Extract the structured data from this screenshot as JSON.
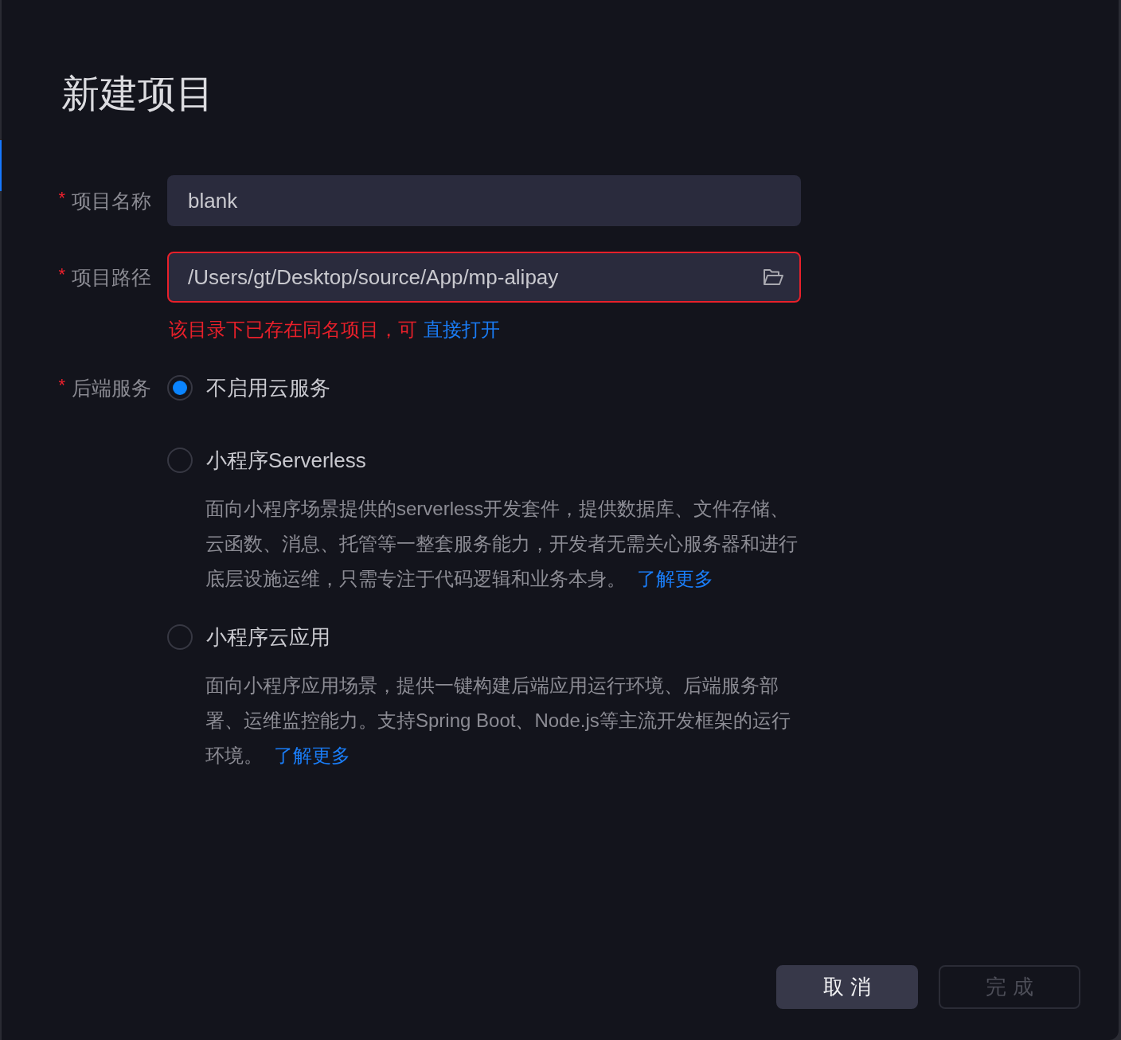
{
  "dialog": {
    "title": "新建项目"
  },
  "fields": [
    {
      "kind": "text",
      "required_mark": "*",
      "label": "项目名称",
      "value": "blank",
      "invalid": false
    },
    {
      "kind": "path",
      "required_mark": "*",
      "label": "项目路径",
      "value": "/Users/gt/Desktop/source/App/mp-alipay",
      "invalid": true,
      "error": {
        "text": "该目录下已存在同名项目，可",
        "link": "直接打开"
      }
    }
  ],
  "backend": {
    "required_mark": "*",
    "label": "后端服务",
    "options": [
      {
        "label": "不启用云服务",
        "selected": true
      },
      {
        "label": "小程序Serverless",
        "selected": false,
        "description": "面向小程序场景提供的serverless开发套件，提供数据库、文件存储、云函数、消息、托管等一整套服务能力，开发者无需关心服务器和进行底层设施运维，只需专注于代码逻辑和业务本身。",
        "link": "了解更多"
      },
      {
        "label": "小程序云应用",
        "selected": false,
        "description": "面向小程序应用场景，提供一键构建后端应用运行环境、后端服务部署、运维监控能力。支持Spring Boot、Node.js等主流开发框架的运行环境。",
        "link": "了解更多"
      }
    ]
  },
  "buttons": [
    {
      "label": "取 消",
      "disabled": false
    },
    {
      "label": "完 成",
      "disabled": true
    }
  ]
}
